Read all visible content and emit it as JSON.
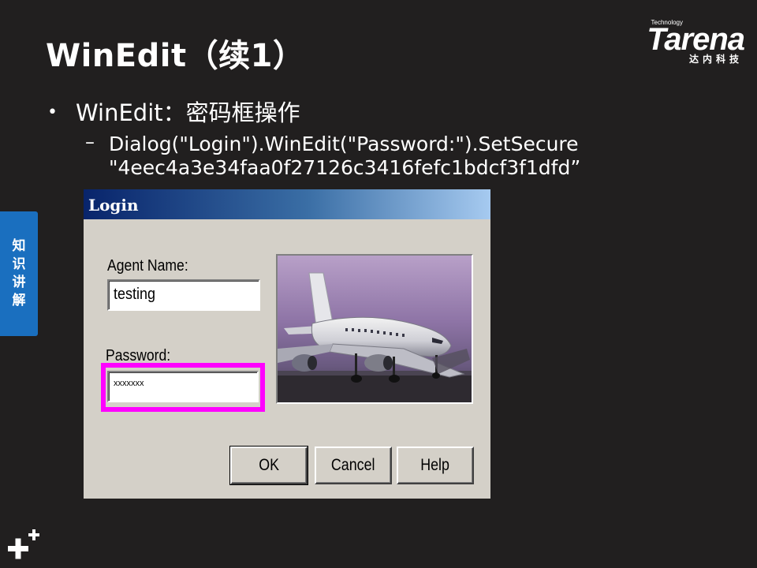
{
  "slide": {
    "title": "WinEdit（续1）",
    "bullet": "WinEdit：密码框操作",
    "sub_dash": "–",
    "sub_line1": "Dialog(\"Login\").WinEdit(\"Password:\").SetSecure",
    "sub_line2": "\"4eec4a3e34faa0f27126c3416fefc1bdcf3f1dfd”"
  },
  "logo": {
    "tech": "Technology",
    "word": "Tarena",
    "sub": "达内科技"
  },
  "side_tab": {
    "chars": [
      "知",
      "识",
      "讲",
      "解"
    ]
  },
  "dialog": {
    "title": "Login",
    "agent_label": "Agent Name:",
    "agent_value": "testing",
    "password_label": "Password:",
    "password_value": "xxxxxxx",
    "highlight_color": "#ff00ff",
    "buttons": {
      "ok": "OK",
      "cancel": "Cancel",
      "help": "Help"
    },
    "image": "airplane-photo"
  },
  "colors": {
    "background": "#211f1f",
    "side_tab": "#1a6fbf",
    "dialog_face": "#d4d0c8"
  }
}
